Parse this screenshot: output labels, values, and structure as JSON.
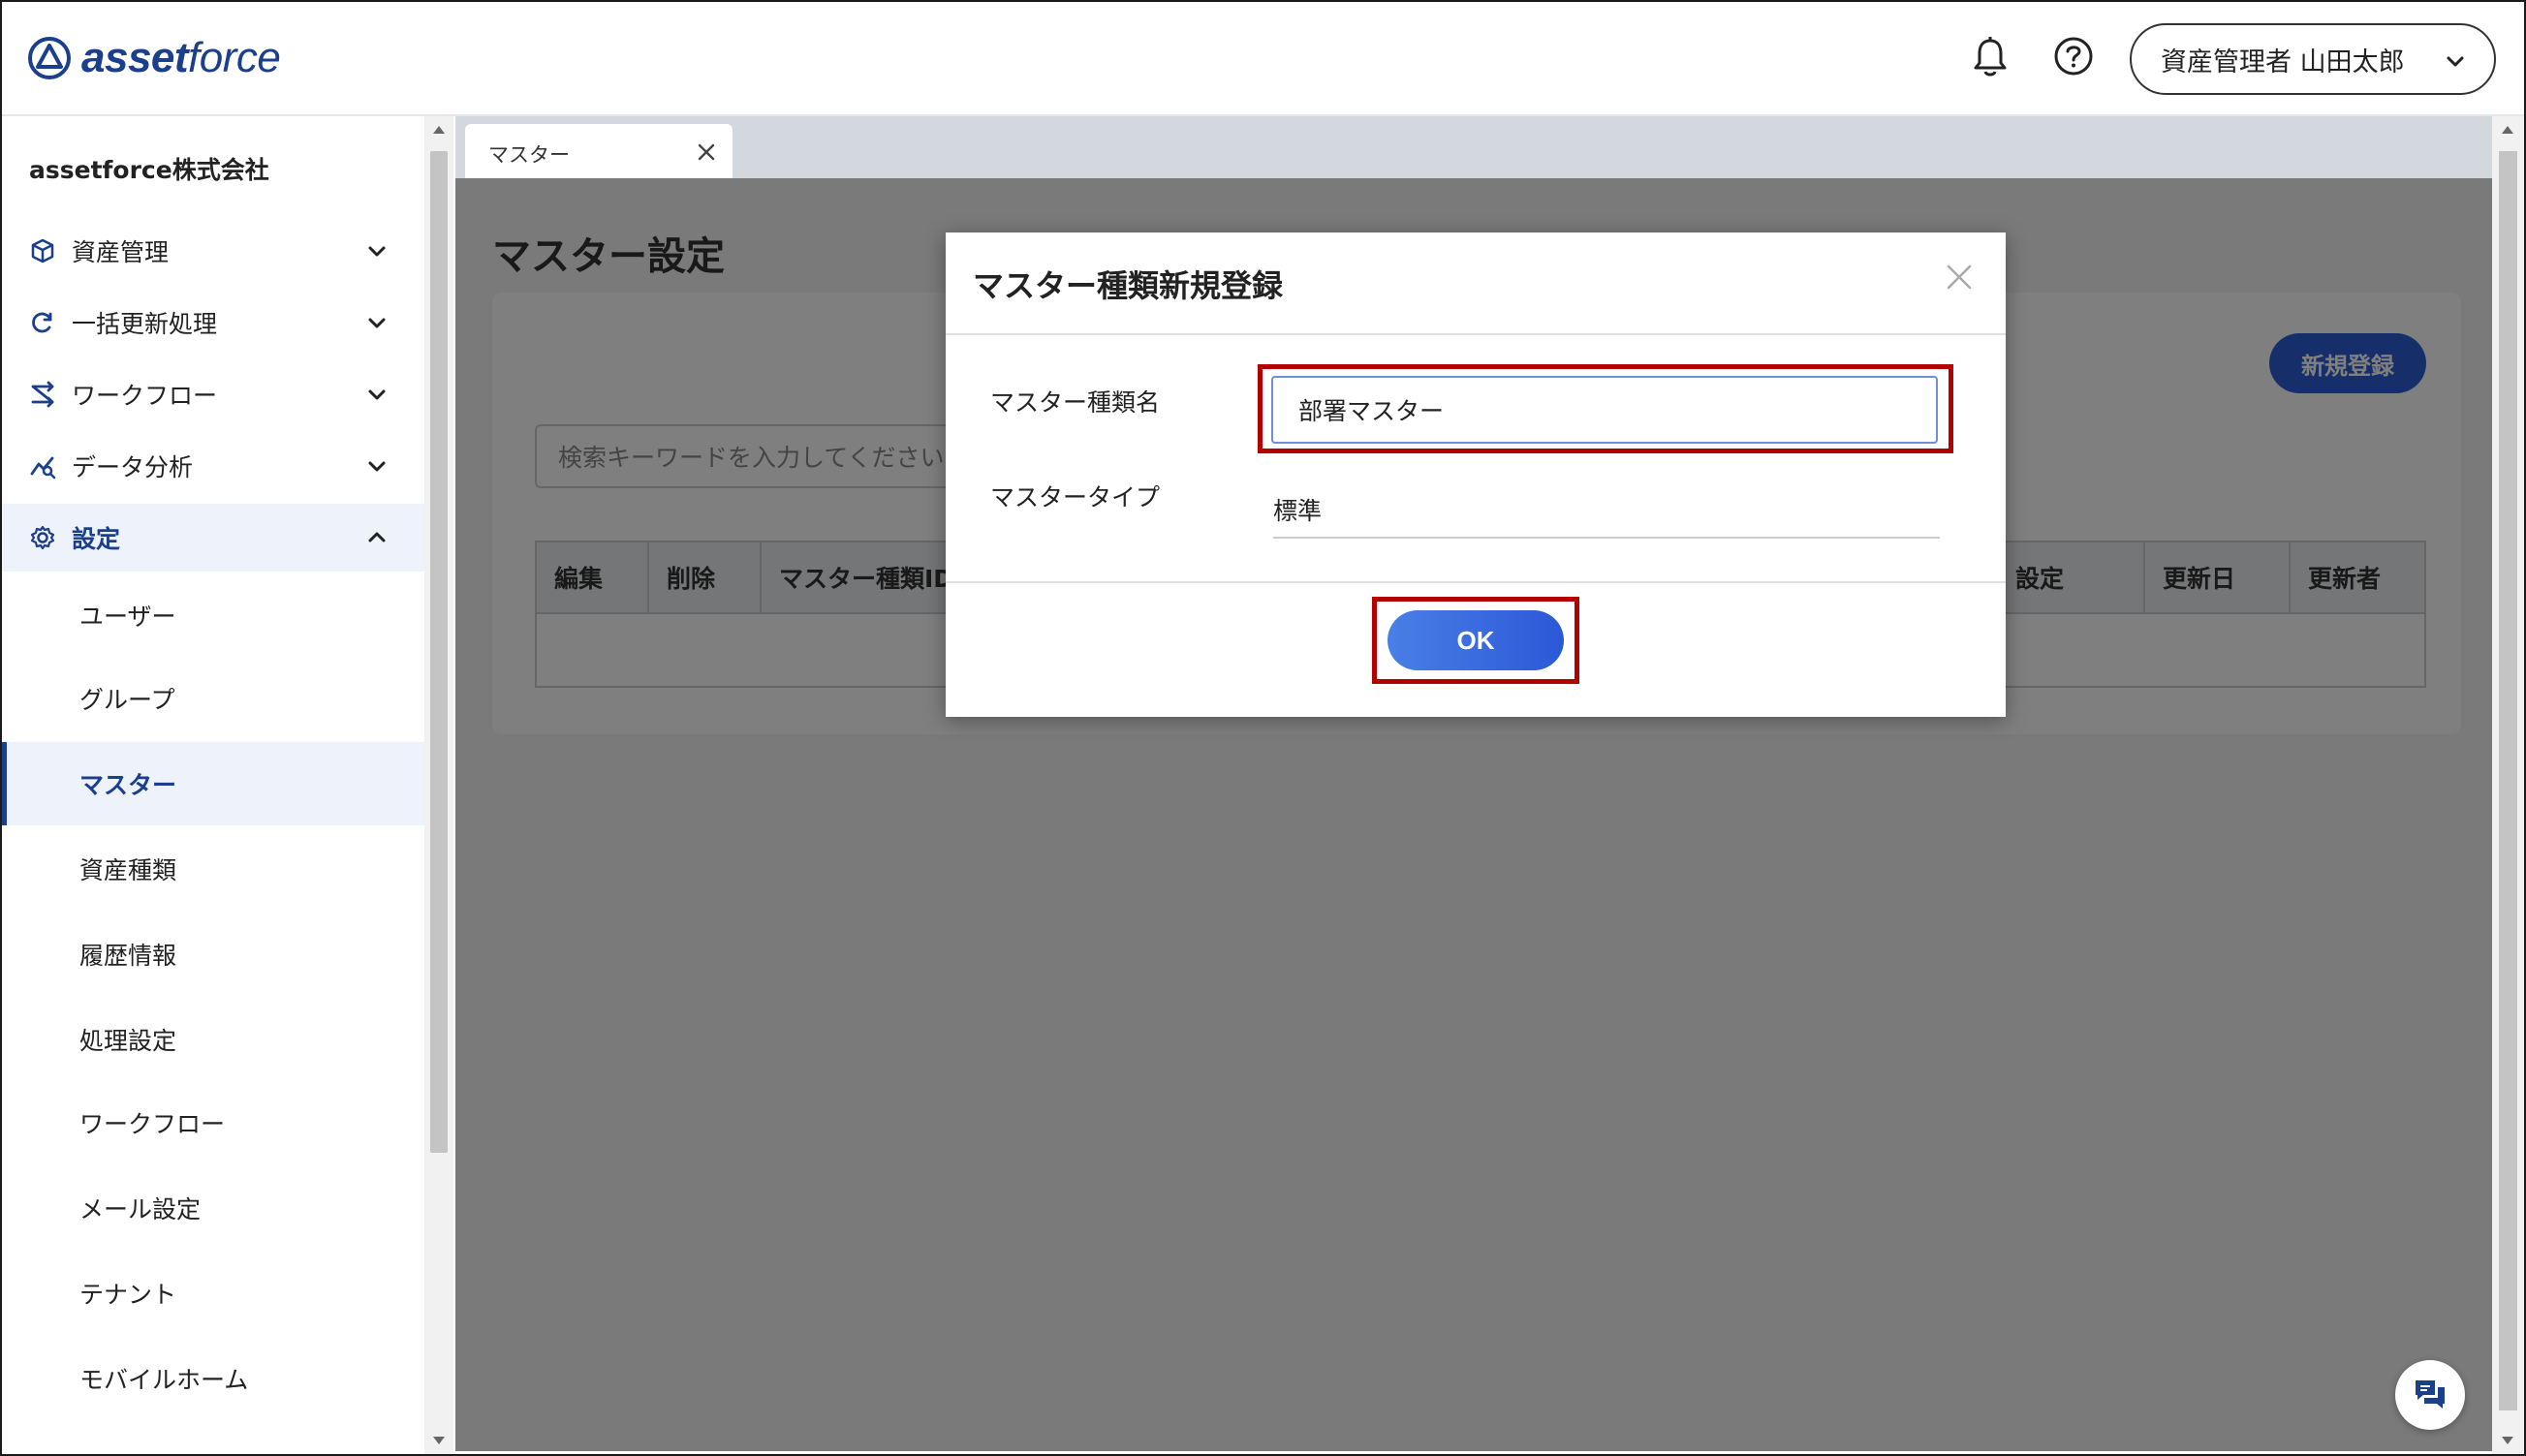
{
  "header": {
    "logo": {
      "bold": "asset",
      "light": "force"
    },
    "user_menu_label": "資産管理者 山田太郎"
  },
  "sidebar": {
    "company": "assetforce株式会社",
    "groups": [
      {
        "label": "資産管理",
        "icon": "cube-icon"
      },
      {
        "label": "一括更新処理",
        "icon": "refresh-icon"
      },
      {
        "label": "ワークフロー",
        "icon": "workflow-icon"
      },
      {
        "label": "データ分析",
        "icon": "analytics-icon"
      },
      {
        "label": "設定",
        "icon": "gear-icon",
        "expanded": true
      }
    ],
    "settings_items": [
      "ユーザー",
      "グループ",
      "マスター",
      "資産種類",
      "履歴情報",
      "処理設定",
      "ワークフロー",
      "メール設定",
      "テナント",
      "モバイルホーム"
    ],
    "selected_item": "マスター"
  },
  "tabs": [
    {
      "label": "マスター"
    }
  ],
  "page": {
    "title": "マスター設定",
    "new_button": "新規登録",
    "search_placeholder": "検索キーワードを入力してください",
    "table_headers": [
      "編集",
      "削除",
      "マスター種類ID",
      "設定",
      "更新日",
      "更新者"
    ]
  },
  "modal": {
    "title": "マスター種類新規登録",
    "name_label": "マスター種類名",
    "name_value": "部署マスター",
    "type_label": "マスタータイプ",
    "type_value": "標準",
    "ok_label": "OK"
  },
  "colors": {
    "brand": "#1b3f8c",
    "primary": "#2c5fd6",
    "highlight": "#b30000"
  }
}
